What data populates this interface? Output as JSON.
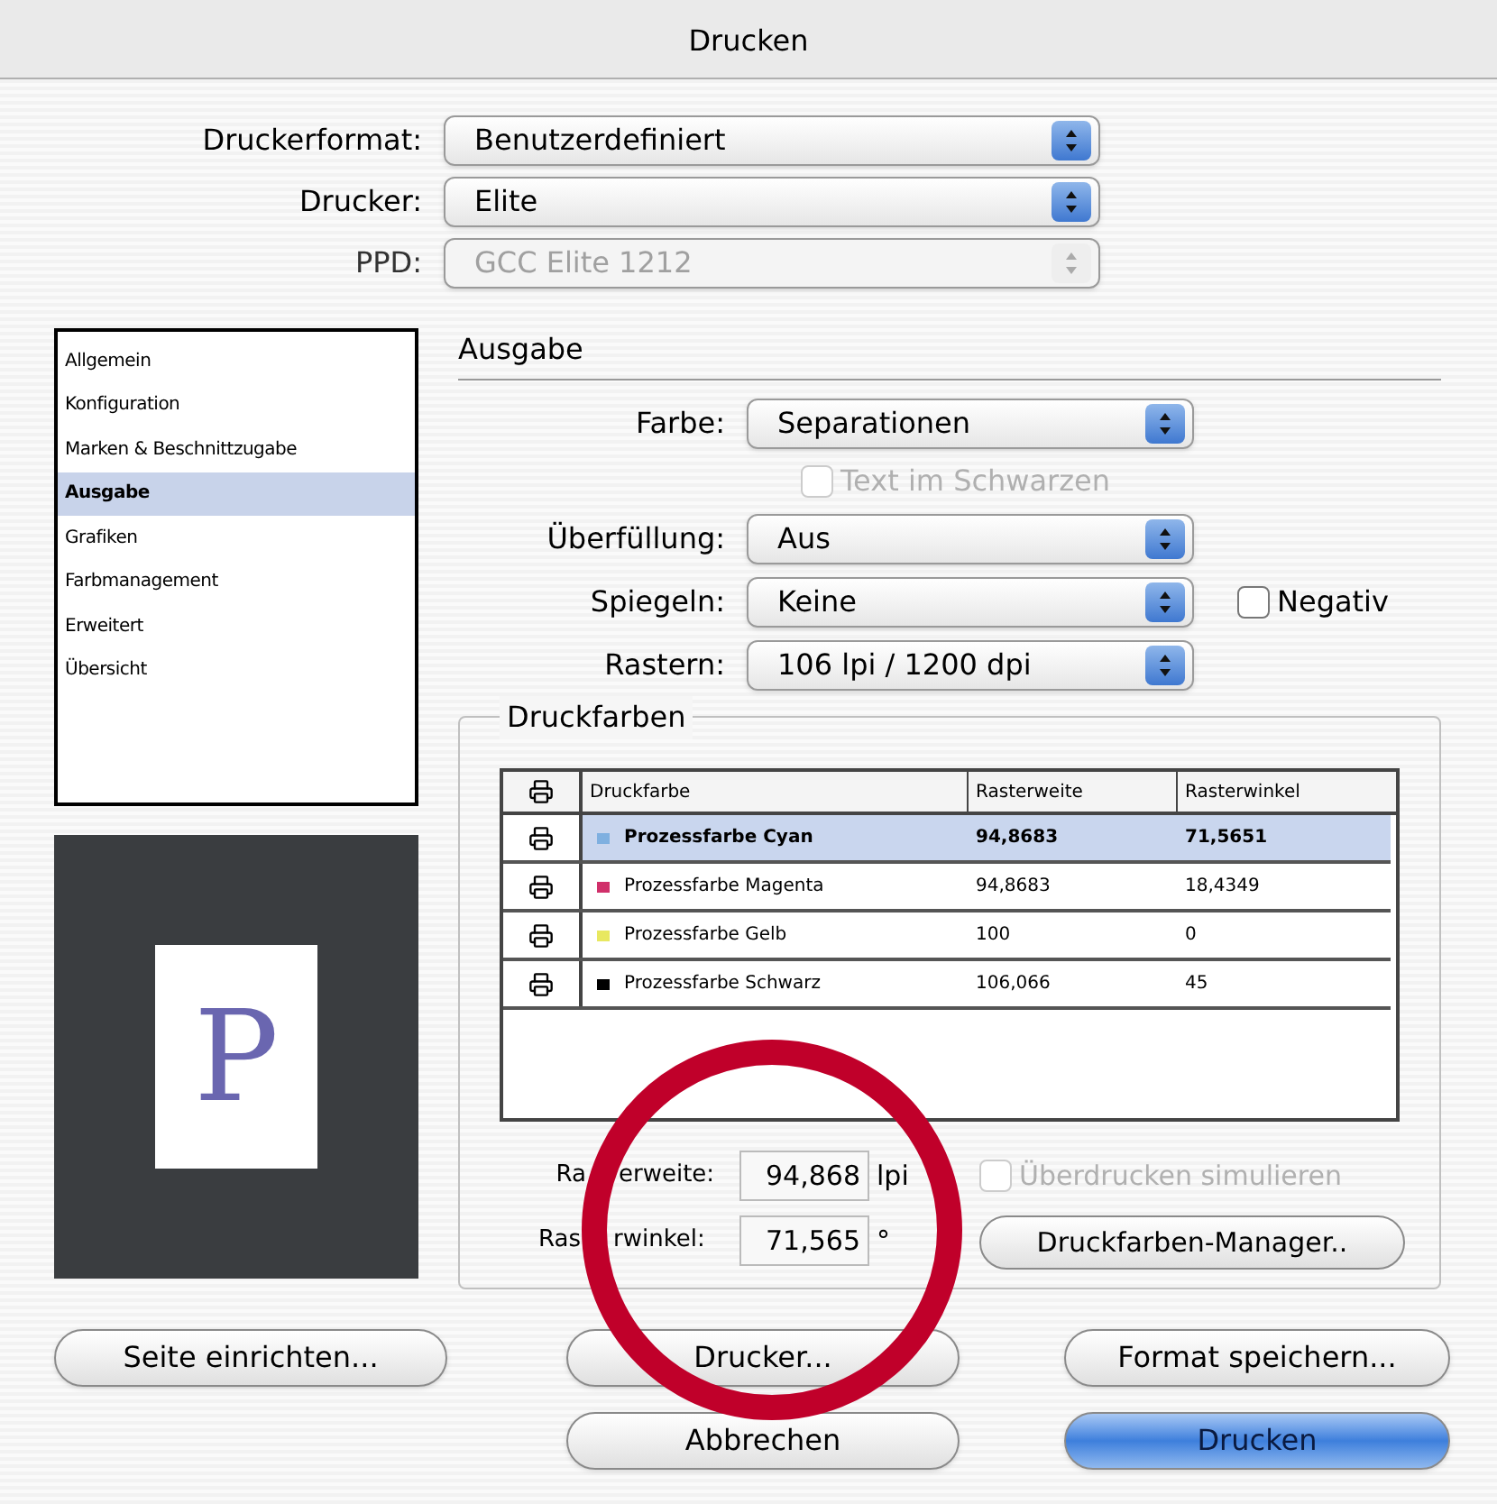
{
  "window": {
    "title": "Drucken"
  },
  "top_fields": [
    {
      "label": "Druckerformat:",
      "value": "Benutzerdefiniert",
      "disabled": false
    },
    {
      "label": "Drucker:",
      "value": "Elite",
      "disabled": false
    },
    {
      "label": "PPD:",
      "value": "GCC Elite 1212",
      "disabled": true
    }
  ],
  "sidebar": {
    "items": [
      {
        "label": "Allgemein",
        "selected": false
      },
      {
        "label": "Konfiguration",
        "selected": false
      },
      {
        "label": "Marken & Beschnittzugabe",
        "selected": false
      },
      {
        "label": "Ausgabe",
        "selected": true
      },
      {
        "label": "Grafiken",
        "selected": false
      },
      {
        "label": "Farbmanagement",
        "selected": false
      },
      {
        "label": "Erweitert",
        "selected": false
      },
      {
        "label": "Übersicht",
        "selected": false
      }
    ]
  },
  "preview": {
    "letter": "P"
  },
  "section_title": "Ausgabe",
  "output_fields": [
    {
      "kind": "select",
      "label": "Farbe:",
      "value": "Separationen"
    },
    {
      "kind": "checkbox",
      "label": "Text im Schwarzen",
      "checked": false,
      "disabled": true
    },
    {
      "kind": "select",
      "label": "Überfüllung:",
      "value": "Aus"
    },
    {
      "kind": "select",
      "label": "Spiegeln:",
      "value": "Keine",
      "checkbox": {
        "label": "Negativ",
        "checked": false
      }
    },
    {
      "kind": "select",
      "label": "Rastern:",
      "value": "106 lpi / 1200 dpi"
    }
  ],
  "inks": {
    "title": "Druckfarben",
    "columns": [
      "Druckfarbe",
      "Rasterweite",
      "Rasterwinkel"
    ],
    "rows": [
      {
        "name": "Prozessfarbe Cyan",
        "color": "#7fb0e0",
        "frequency": "94,8683",
        "angle": "71,5651",
        "selected": true
      },
      {
        "name": "Prozessfarbe Magenta",
        "color": "#d0306a",
        "frequency": "94,8683",
        "angle": "18,4349",
        "selected": false
      },
      {
        "name": "Prozessfarbe Gelb",
        "color": "#e8e860",
        "frequency": "100",
        "angle": "0",
        "selected": false
      },
      {
        "name": "Prozessfarbe Schwarz",
        "color": "#000000",
        "frequency": "106,066",
        "angle": "45",
        "selected": false
      }
    ],
    "frequency": {
      "label_parts": [
        "Ra",
        "erweite:"
      ],
      "value": "94,868",
      "unit": "lpi"
    },
    "angle": {
      "label_parts": [
        "Ras",
        "rwinkel:"
      ],
      "value": "71,565",
      "unit": "°"
    },
    "simulate": {
      "label": "Überdrucken simulieren",
      "checked": false,
      "disabled": true
    },
    "manager_button": "Druckfarben-Manager.."
  },
  "buttons": [
    {
      "label": "Seite einrichten...",
      "default": false
    },
    {
      "label": "Drucker...",
      "default": false
    },
    {
      "label": "Format speichern...",
      "default": false
    },
    {
      "label": "Abbrechen",
      "default": false
    },
    {
      "label": "Drucken",
      "default": true
    }
  ]
}
